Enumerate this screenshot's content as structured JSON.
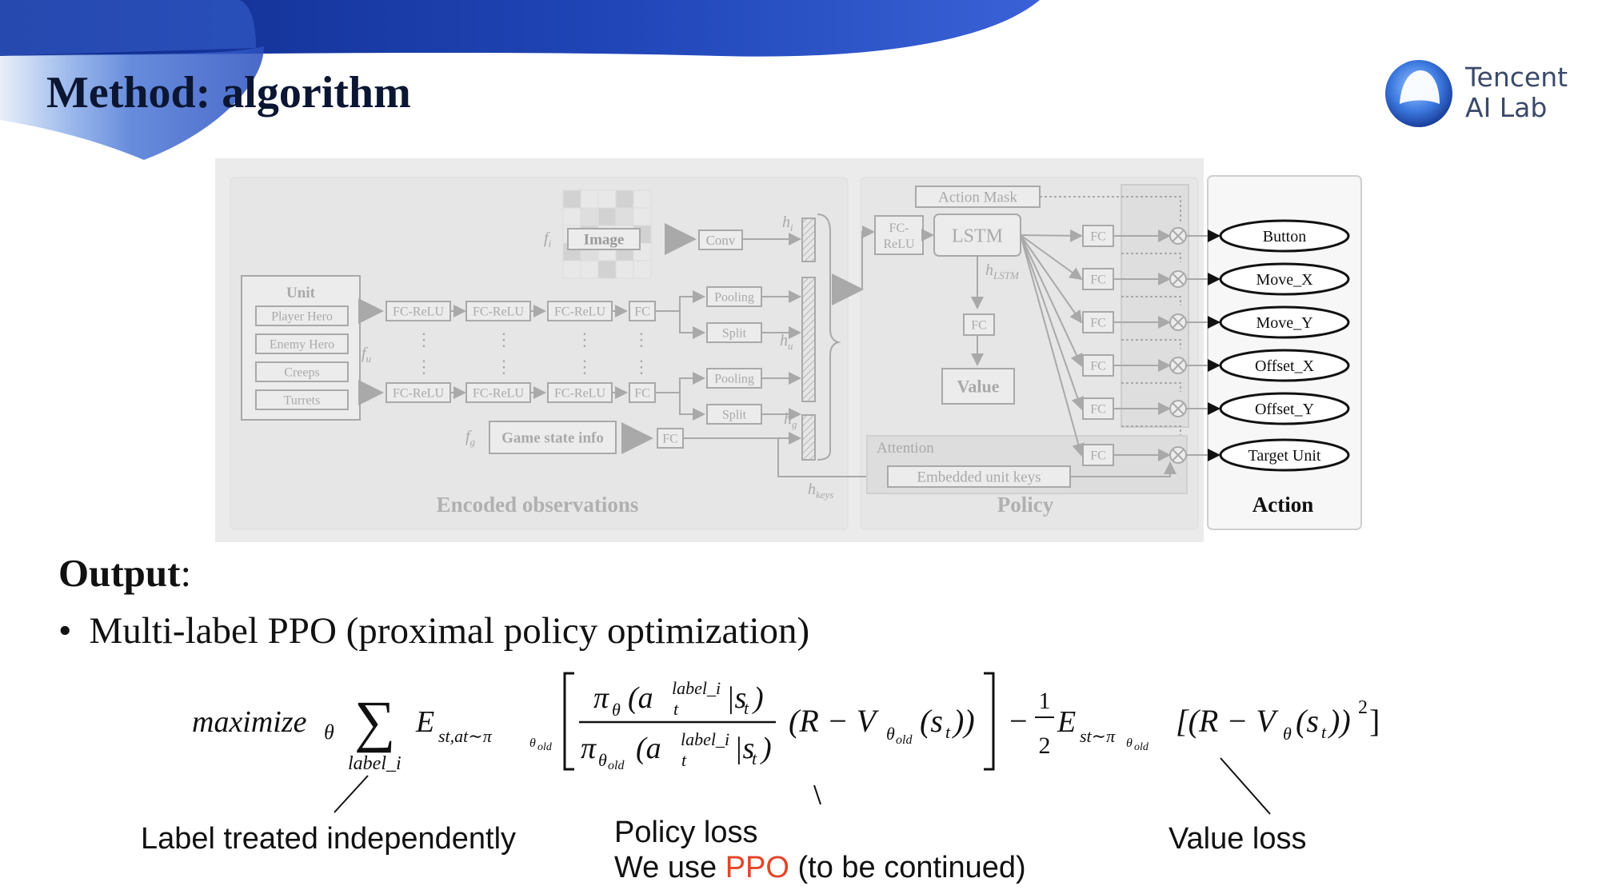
{
  "slide": {
    "title": "Method: algorithm",
    "logo": {
      "line1": "Tencent",
      "line2": "AI Lab",
      "icon": "tencent-ai-lab-logo-icon"
    }
  },
  "diagram": {
    "sections": {
      "encoded": "Encoded observations",
      "policy": "Policy",
      "action": "Action"
    },
    "unit": {
      "header": "Unit",
      "items": [
        "Player Hero",
        "Enemy Hero",
        "Creeps",
        "Turrets"
      ]
    },
    "nodes": {
      "image": "Image",
      "conv": "Conv",
      "fc_relu": "FC-ReLU",
      "fc": "FC",
      "pooling": "Pooling",
      "split": "Split",
      "game_state": "Game state info",
      "action_mask": "Action Mask",
      "fc_relu_split": [
        "FC-",
        "ReLU"
      ],
      "lstm": "LSTM",
      "value": "Value",
      "attention": "Attention",
      "embedded_keys": "Embedded unit keys"
    },
    "symbols": {
      "fi": "f",
      "fi_sub": "i",
      "fu": "f",
      "fu_sub": "u",
      "fg": "f",
      "fg_sub": "g",
      "hi": "h",
      "hi_sub": "i",
      "hu": "h",
      "hu_sub": "u",
      "hg": "h",
      "hg_sub": "g",
      "hkeys": "h",
      "hkeys_sub": "keys",
      "hlstm": "h",
      "hlstm_sub": "LSTM"
    },
    "actions": [
      "Button",
      "Move_X",
      "Move_Y",
      "Offset_X",
      "Offset_Y",
      "Target Unit"
    ]
  },
  "output": {
    "heading": "Output",
    "heading_suffix": ":",
    "bullet": "Multi-label PPO (proximal policy optimization)"
  },
  "formula": {
    "maximize": "maximize",
    "theta": "θ",
    "sum": "∑",
    "sum_index": "label_i",
    "E": "E",
    "E1_sub": "s",
    "E1_sub_t": "t",
    "E1_sub_rest": ",a",
    "E1_sub_t2": "t",
    "E1_sub_tail": "∼π",
    "E1_sub_sub": "θ",
    "E1_sub_old": "old",
    "num": "π",
    "num_sub": "θ",
    "num_paren": "(a",
    "sup_label": "label_i",
    "t": "t",
    "bar_s": "|s",
    "close_paren": ")",
    "den": "π",
    "den_sub": "θ",
    "den_old": "old",
    "adv": "(R − V",
    "adv_sub": "θ",
    "adv_old": "old",
    "adv_tail": "(s",
    "adv_close": "))",
    "minus": "−",
    "half_num": "1",
    "half_den": "2",
    "E2_sub": "s",
    "E2_t": "t",
    "E2_rest": "∼π",
    "E2_theta": "θ",
    "E2_old": "old",
    "v_term": "[(R − V",
    "v_sub": "θ",
    "v_tail": "(s",
    "v_close": "))",
    "v_sq": "2",
    "v_bracket": "]"
  },
  "notes": {
    "label": "Label treated independently",
    "policy_line1": "Policy loss",
    "policy_line2_pre": "We use ",
    "policy_line2_ppo": "PPO",
    "policy_line2_post": " (to be continued)",
    "value": "Value loss"
  },
  "colors": {
    "title": "#0b1633",
    "banner_dark": "#1f3fae",
    "banner_light": "#5d86e0",
    "ppo": "#e2452a",
    "diagram_bg": "#ececec",
    "faded": "#a9a9a9"
  }
}
